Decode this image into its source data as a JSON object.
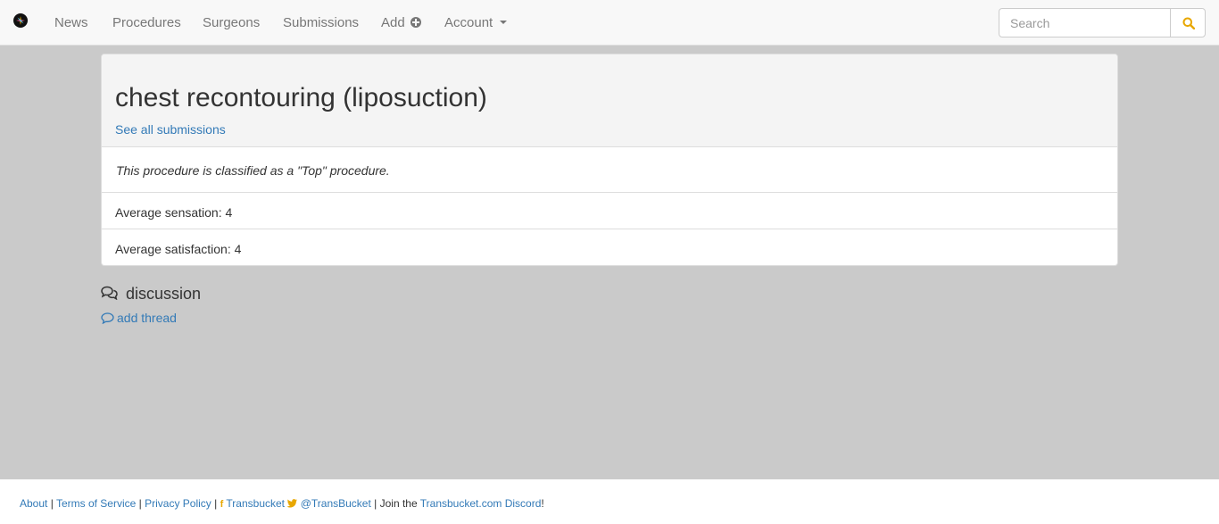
{
  "nav": {
    "items": [
      "News",
      "Procedures",
      "Surgeons",
      "Submissions"
    ],
    "add_label": "Add",
    "account_label": "Account"
  },
  "search": {
    "placeholder": "Search"
  },
  "panel": {
    "title": "chest recontouring (liposuction)",
    "see_all_link": "See all submissions",
    "classification": "This procedure is classified as a \"Top\" procedure.",
    "stats": [
      "Average sensation: 4",
      "Average satisfaction: 4"
    ]
  },
  "discussion": {
    "heading": "discussion",
    "add_thread": "add thread"
  },
  "footer": {
    "about": "About",
    "terms": "Terms of Service",
    "privacy": "Privacy Policy",
    "facebook": "Transbucket",
    "twitter": "@TransBucket",
    "join_text": "Join the",
    "discord": "Transbucket.com Discord",
    "exclaim": "!",
    "separator": "|"
  },
  "icons": {
    "logo": "transbucket-logo-icon",
    "add": "plus-circle-icon",
    "account": "caret-down-icon",
    "search": "search-icon",
    "discussion": "comments-icon",
    "add_thread": "comment-icon",
    "facebook": "facebook-icon",
    "twitter": "twitter-icon"
  },
  "colors": {
    "link": "#337ab7",
    "search_icon": "#e8a700",
    "page_background": "#cacaca"
  }
}
